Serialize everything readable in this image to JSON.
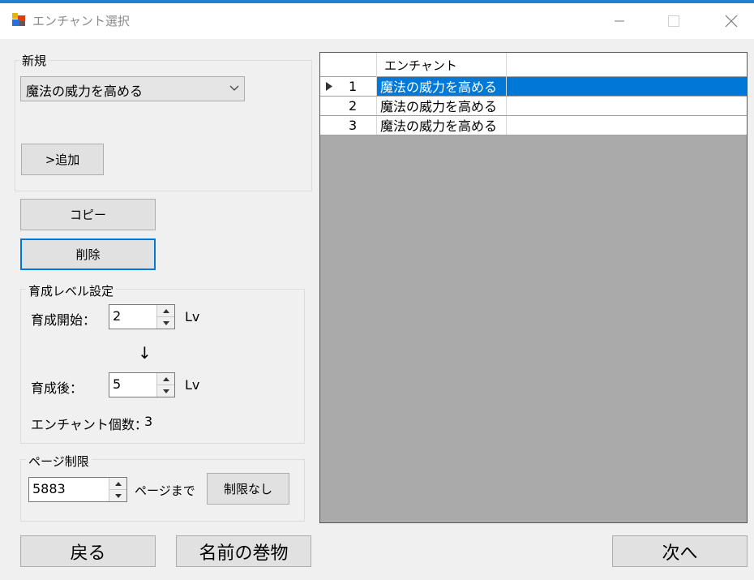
{
  "window": {
    "title": "エンチャント選択",
    "icons": {
      "app": "app-icon",
      "minimize": "minimize-icon",
      "maximize": "maximize-icon",
      "close": "close-icon"
    }
  },
  "new_group": {
    "label": "新規",
    "combo_value": "魔法の威力を高める",
    "add_button": ">追加"
  },
  "copy_button": "コピー",
  "delete_button": "削除",
  "level_group": {
    "label": "育成レベル設定",
    "start_label": "育成開始：",
    "start_value": "2",
    "start_unit": "Lv",
    "arrow": "↓",
    "after_label": "育成後：",
    "after_value": "5",
    "after_unit": "Lv",
    "count_label": "エンチャント個数：",
    "count_value": "3"
  },
  "page_group": {
    "label": "ページ制限",
    "page_value": "5883",
    "page_suffix": "ページまで",
    "no_limit_button": "制限なし"
  },
  "grid": {
    "column_header": "エンチャント",
    "rows": [
      {
        "num": "1",
        "value": "魔法の威力を高める",
        "selected": true
      },
      {
        "num": "2",
        "value": "魔法の威力を高める",
        "selected": false
      },
      {
        "num": "3",
        "value": "魔法の威力を高める",
        "selected": false
      }
    ]
  },
  "footer": {
    "back_button": "戻る",
    "scroll_button": "名前の巻物",
    "next_button": "次へ"
  },
  "colors": {
    "accent": "#0078d7",
    "grid_background": "#aaaaaa",
    "button_face": "#e1e1e1"
  }
}
